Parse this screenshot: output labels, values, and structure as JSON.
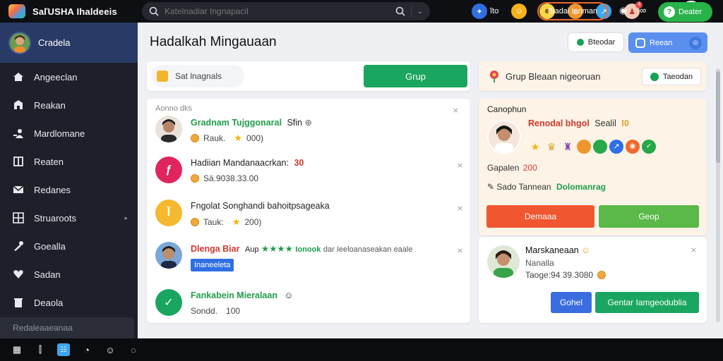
{
  "app": {
    "title": "SaľUSHA Ihaldeeis"
  },
  "search": {
    "placeholder": "Katelnadiar Ingnapacil"
  },
  "topbar": {
    "label": "ĩto",
    "icons": [
      "globe-icon",
      "smile-icon",
      "sun-icon",
      "fire-icon",
      "share-icon",
      "bell-icon"
    ],
    "bell_badge": "4"
  },
  "sidebar": {
    "user": "Cradela",
    "items": [
      {
        "label": "Angeeclan",
        "icon": "home-icon"
      },
      {
        "label": "Reakan",
        "icon": "building-icon"
      },
      {
        "label": "Mardlomane",
        "icon": "people-icon"
      },
      {
        "label": "Reaten",
        "icon": "document-icon"
      },
      {
        "label": "Redanes",
        "icon": "mail-icon"
      },
      {
        "label": "Struaroots",
        "icon": "grid-icon"
      },
      {
        "label": "Goealla",
        "icon": "tools-icon"
      },
      {
        "label": "Sadan",
        "icon": "heart-icon"
      },
      {
        "label": "Deaola",
        "icon": "trash-icon"
      }
    ],
    "bottom": "Redaleaaeanaa"
  },
  "main": {
    "title": "Hadalkah Mingauaan",
    "btn_secondary": "Bteodar",
    "btn_primary": "Reean"
  },
  "filter": {
    "pill": "Sat lnagnals",
    "button": "Grup"
  },
  "feed": {
    "header": "Aonno dks",
    "rows": [
      {
        "name": "Gradnam Tujggonaral",
        "suffix": "Sfin",
        "line2": "Rauk.",
        "value": "000)",
        "avatar": "photo-man"
      },
      {
        "name": "Hadiian Mandanaacrkan:",
        "suffix": "30",
        "line2": "Sä.9038.33.00",
        "value": "",
        "avatar": "letter-f"
      },
      {
        "name": "Fngolat Songhandi bahoitpsageaka",
        "suffix": "",
        "line2": "Tauk:",
        "value": "200)",
        "avatar": "letter-i"
      },
      {
        "name": "Dlenga Biar",
        "middle": "Aup",
        "stars": "★★★★",
        "tag": "Ionook",
        "rest": "dar Ieeloanaseakan eaale",
        "line2": "Inaneeleta",
        "avatar": "photo-woman"
      },
      {
        "name": "Fankabein Mieralaan",
        "line2": "Sondd.",
        "value": "100",
        "avatar": "check-icon"
      }
    ]
  },
  "notice": {
    "text": "Grup Bleaan nigeoruan",
    "button": "Taeodan"
  },
  "profile": {
    "title": "Canophun",
    "name": "Renodal bhgol",
    "name_suffix": "Sealil",
    "name_num": "I0",
    "stat_label": "Gapalen",
    "stat_value": "200",
    "meta_label": "Sado Tannean",
    "meta_value": "Dolomanrag",
    "btn1": "Demaaa",
    "btn2": "Geop"
  },
  "card2": {
    "name": "Marskaneaan",
    "sub": "Nanalla",
    "meta": "Taoge:94 39.3080",
    "btn1": "Gohel",
    "btn2": "Gentar Iamgeodublia"
  },
  "taskbar": {
    "pill": "Biadai Ienman",
    "cta": "Deater"
  },
  "colors": {
    "accent_green": "#1aa660",
    "accent_blue": "#5a8ff0",
    "accent_orange": "#f0562f",
    "sidebar_bg": "#1d2029",
    "topbar_bg": "#0e0f13"
  }
}
